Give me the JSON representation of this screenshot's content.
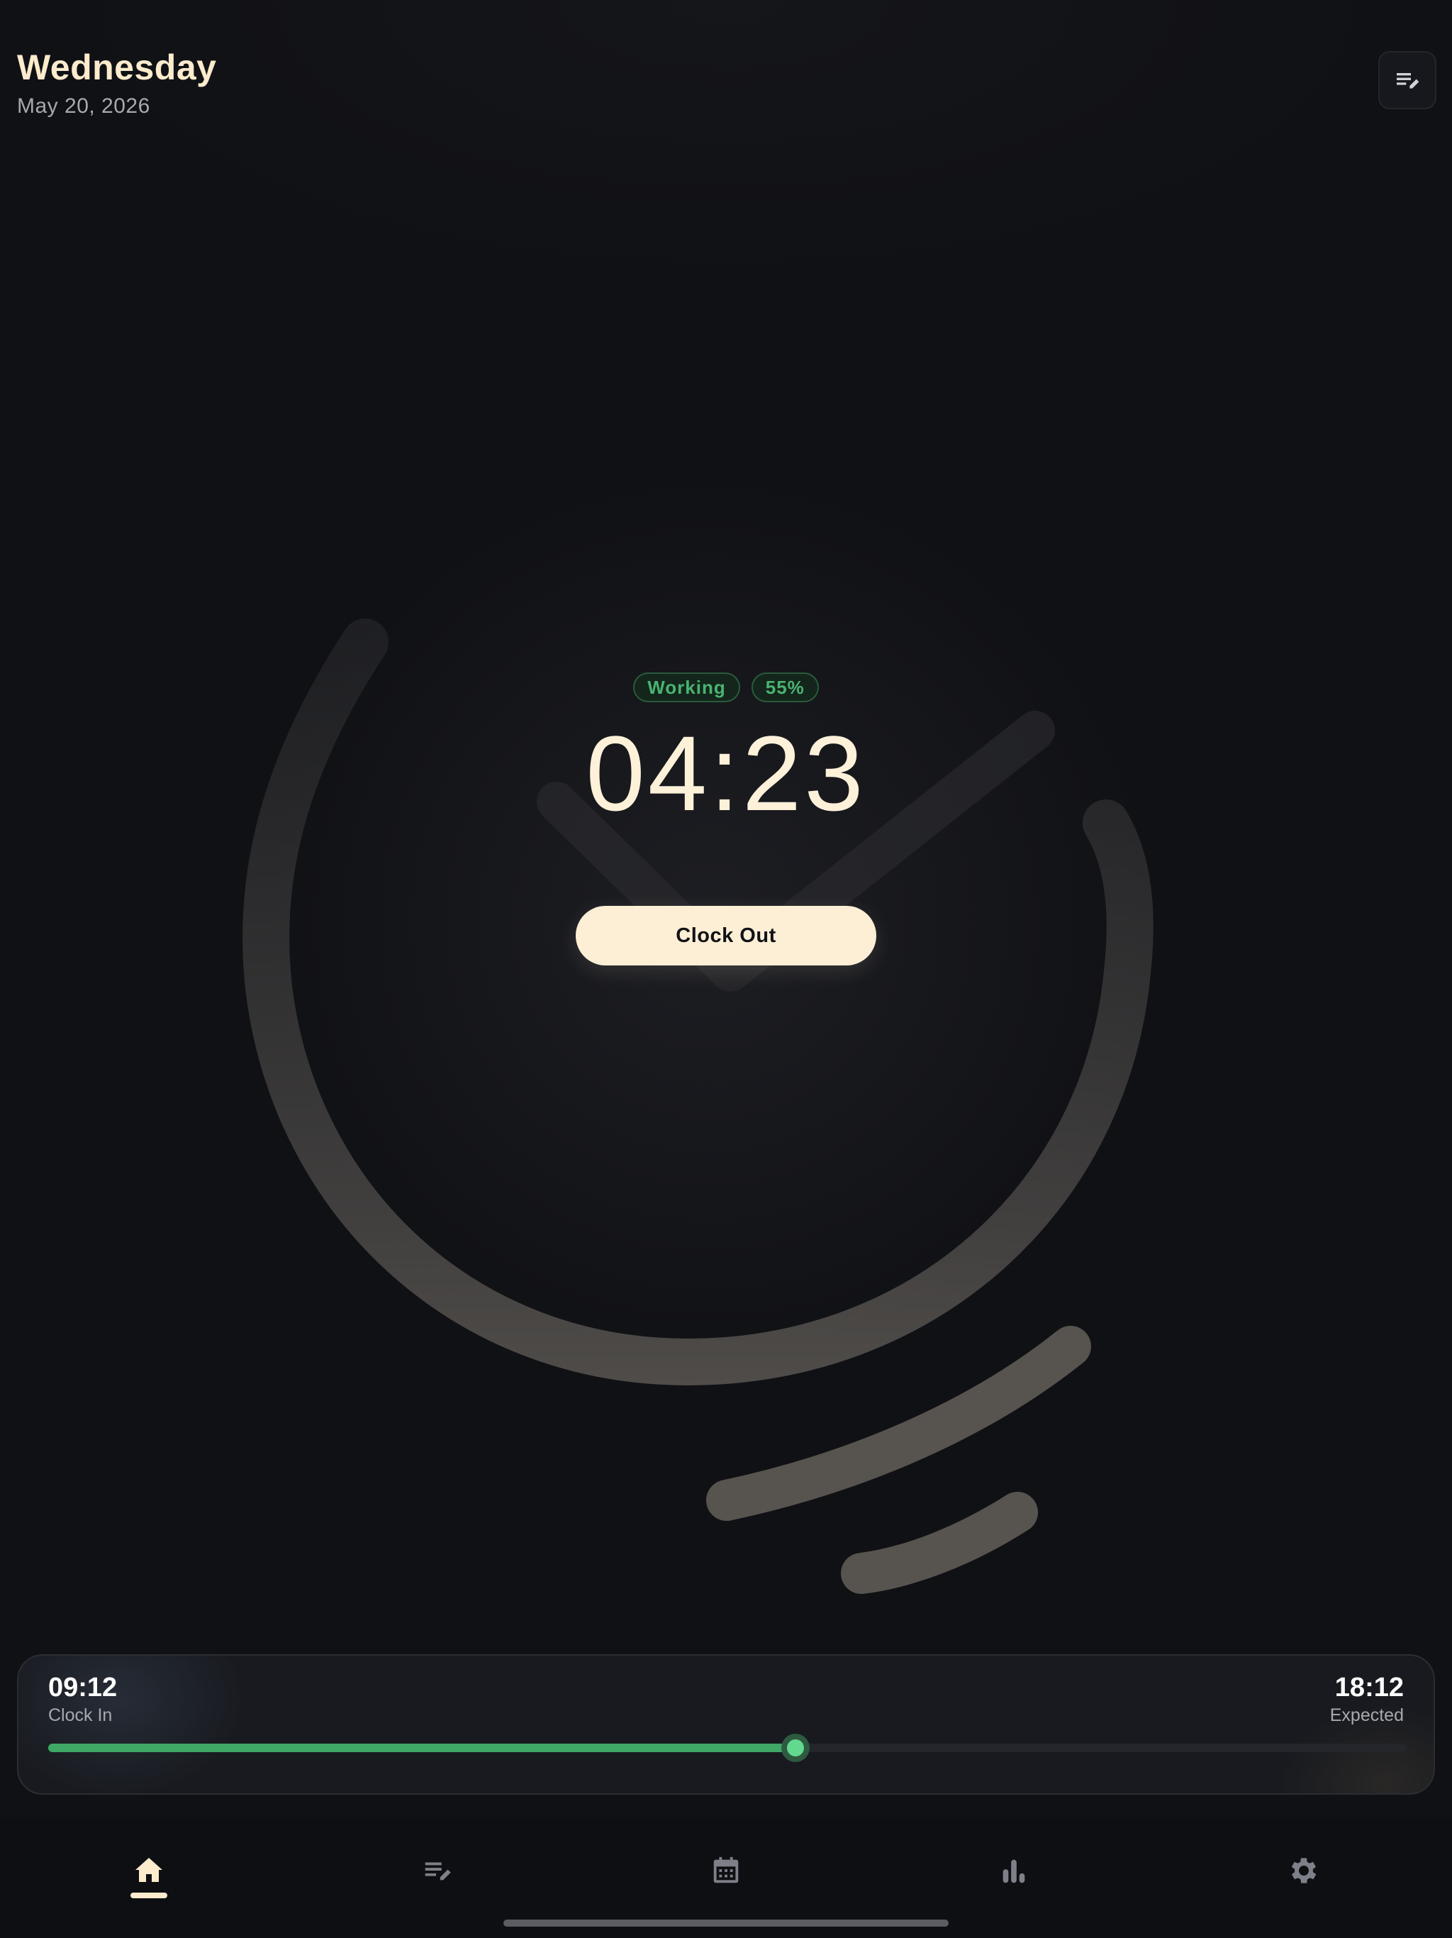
{
  "header": {
    "day": "Wednesday",
    "date": "May 20, 2026",
    "edit_icon": "edit-notes-icon"
  },
  "status": {
    "state_label": "Working",
    "progress_label": "55%",
    "progress_fraction": 0.55,
    "elapsed": "04:23",
    "action_label": "Clock Out"
  },
  "shift": {
    "clock_in_time": "09:12",
    "clock_in_label": "Clock In",
    "expected_time": "18:12",
    "expected_label": "Expected"
  },
  "nav": {
    "items": [
      {
        "id": "home",
        "icon": "home-icon",
        "active": true
      },
      {
        "id": "entries",
        "icon": "edit-notes-icon",
        "active": false
      },
      {
        "id": "calendar",
        "icon": "calendar-icon",
        "active": false
      },
      {
        "id": "stats",
        "icon": "bar-chart-icon",
        "active": false
      },
      {
        "id": "settings",
        "icon": "gear-icon",
        "active": false
      }
    ]
  },
  "colors": {
    "accent": "#fdefd6",
    "working_green": "#3fa866",
    "background": "#101115"
  }
}
